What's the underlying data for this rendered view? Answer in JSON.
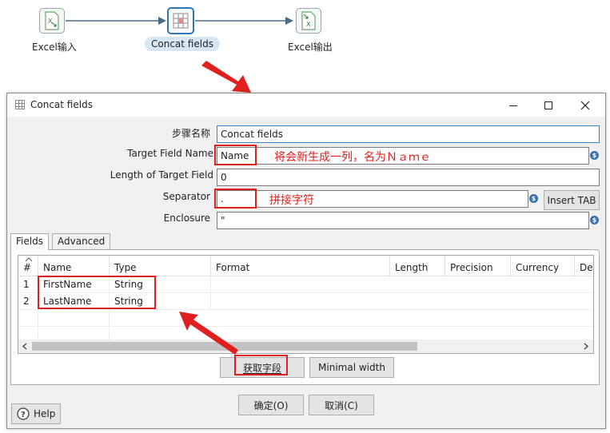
{
  "flow": {
    "steps": [
      {
        "label": "Excel输入",
        "icon": "excel-input-icon"
      },
      {
        "label": "Concat fields",
        "icon": "concat-fields-icon"
      },
      {
        "label": "Excel输出",
        "icon": "excel-output-icon"
      }
    ]
  },
  "dialog": {
    "title": "Concat fields",
    "fields": {
      "step_name_label": "步骤名称",
      "step_name_value": "Concat fields",
      "target_field_label": "Target Field Name",
      "target_field_value": "Name",
      "length_label": "Length of Target Field",
      "length_value": "0",
      "separator_label": "Separator",
      "separator_value": ".",
      "enclosure_label": "Enclosure",
      "enclosure_value": "\""
    },
    "insert_tab_label": "Insert TAB",
    "tabs": [
      "Fields",
      "Advanced"
    ],
    "table": {
      "columns": [
        "#",
        "Name",
        "Type",
        "Format",
        "Length",
        "Precision",
        "Currency",
        "De"
      ],
      "rows": [
        {
          "num": "1",
          "name": "FirstName",
          "type": "String"
        },
        {
          "num": "2",
          "name": "LastName",
          "type": "String"
        }
      ]
    },
    "get_fields_label": "获取字段",
    "minimal_width_label": "Minimal width",
    "ok_label": "确定(O)",
    "cancel_label": "取消(C)",
    "help_label": "Help"
  },
  "annotations": {
    "target_note": "将会新生成一列，名为Ｎａｍｅ",
    "separator_note": "拼接字符"
  },
  "colors": {
    "annotation_red": "#e0201f",
    "selection_blue": "#2c78b8",
    "label_highlight": "#d6e6f3"
  }
}
